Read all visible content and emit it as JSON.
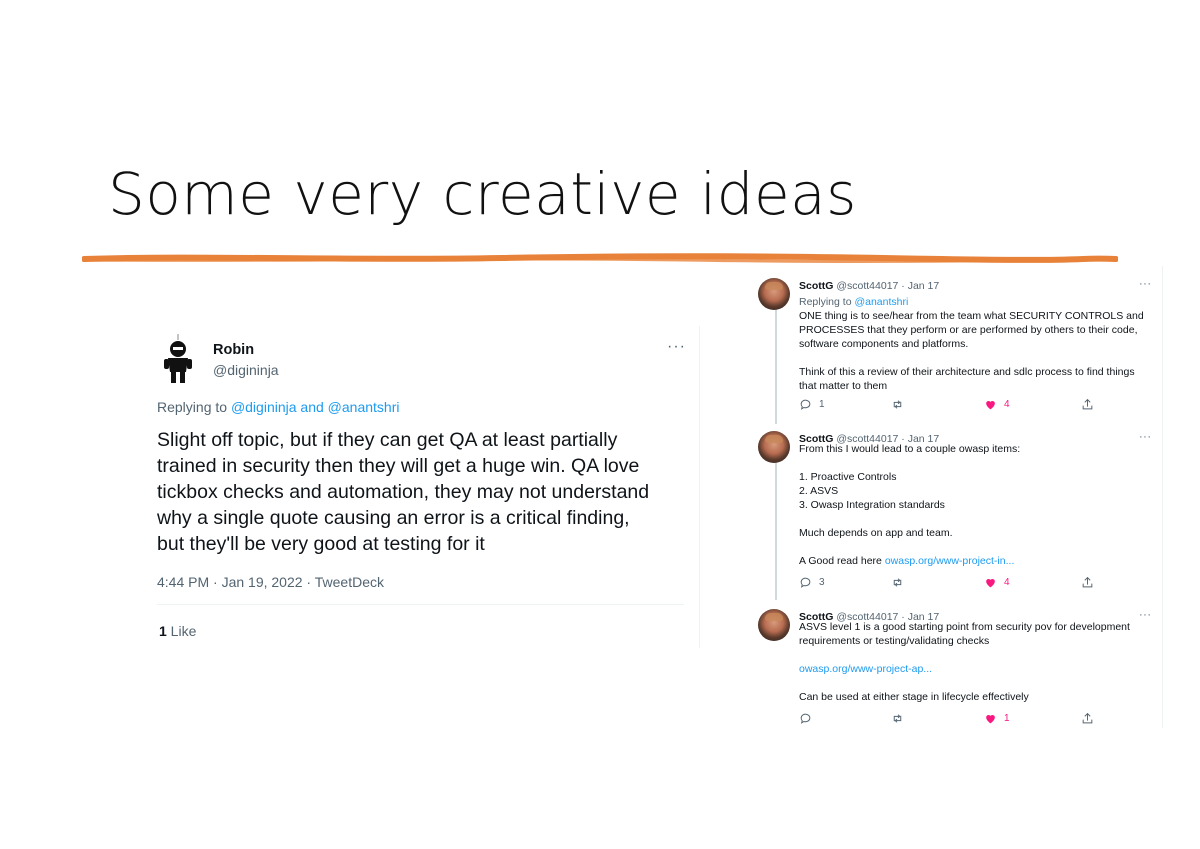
{
  "slide": {
    "title": "Some very creative ideas"
  },
  "left_tweet": {
    "name": "Robin",
    "handle": "@digininja",
    "more": "···",
    "reply_prefix": "Replying to ",
    "reply_to": "@digininja and @anantshri",
    "lines": [
      "Slight off topic, but if they can get QA at least partially",
      "trained in security then they will get a huge win. QA love",
      "tickbox checks and automation, they may not understand",
      "why a single quote causing an error is a critical finding,",
      "but they'll be very good at testing for it"
    ],
    "meta": "4:44 PM · Jan 19, 2022 · TweetDeck",
    "likes_count": "1",
    "likes_label": " Like"
  },
  "thread": [
    {
      "name": "ScottG",
      "handle": "@scott44017",
      "date": "· Jan 17",
      "more": "···",
      "reply_prefix": "Replying to ",
      "reply_to": "@anantshri",
      "lines": [
        "ONE thing is to see/hear from the team what SECURITY CONTROLS and",
        "PROCESSES that they perform or are performed by others to their code,",
        "software components and platforms.",
        "",
        "Think of this a review of their architecture and sdlc process to find things",
        "that matter to them"
      ],
      "replies": "1",
      "retweets": "",
      "likes": "4"
    },
    {
      "name": "ScottG",
      "handle": "@scott44017",
      "date": "· Jan 17",
      "more": "···",
      "lines": [
        "From this I would lead to a couple owasp items:",
        "",
        "1. Proactive Controls",
        "2. ASVS",
        "3. Owasp Integration standards",
        "",
        "Much depends on app and team.",
        ""
      ],
      "link_prefix": "A Good read here ",
      "link": "owasp.org/www-project-in...",
      "replies": "3",
      "retweets": "",
      "likes": "4"
    },
    {
      "name": "ScottG",
      "handle": "@scott44017",
      "date": "· Jan 17",
      "more": "···",
      "lines": [
        "ASVS level 1 is a good starting point from security pov for development",
        "requirements or testing/validating checks",
        ""
      ],
      "link": "owasp.org/www-project-ap...",
      "tail": "Can be used at either stage in lifecycle effectively",
      "replies": "",
      "retweets": "",
      "likes": "1"
    }
  ],
  "colors": {
    "accent_orange": "#e8823a",
    "link_blue": "#1d9bf0",
    "like_pink": "#f91880",
    "muted": "#536471"
  },
  "icons": [
    "reply-icon",
    "retweet-icon",
    "heart-icon",
    "share-icon",
    "more-icon"
  ]
}
